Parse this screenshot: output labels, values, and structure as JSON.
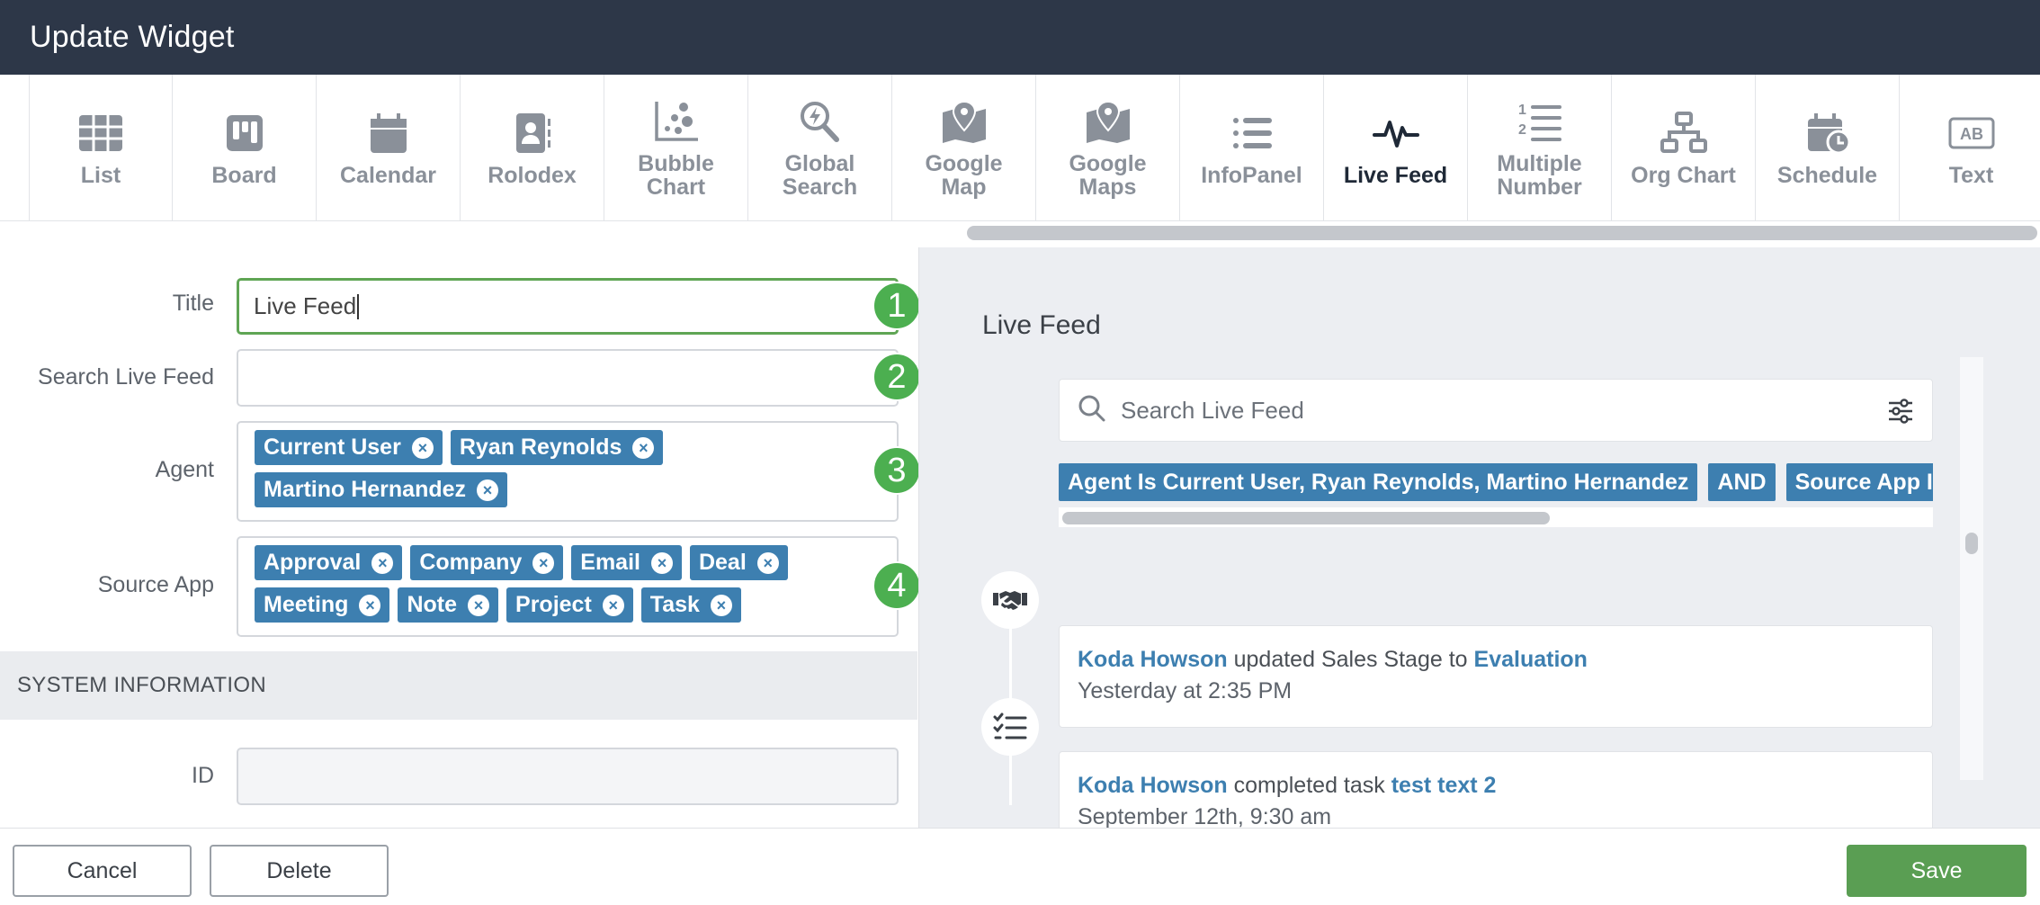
{
  "header": {
    "title": "Update Widget"
  },
  "widget_types": [
    {
      "label": "List",
      "icon": "list-icon",
      "active": false
    },
    {
      "label": "Board",
      "icon": "board-icon",
      "active": false
    },
    {
      "label": "Calendar",
      "icon": "calendar-icon",
      "active": false
    },
    {
      "label": "Rolodex",
      "icon": "rolodex-icon",
      "active": false
    },
    {
      "label": "Bubble\nChart",
      "icon": "bubble-chart-icon",
      "active": false
    },
    {
      "label": "Global\nSearch",
      "icon": "global-search-icon",
      "active": false
    },
    {
      "label": "Google\nMap",
      "icon": "map-icon",
      "active": false
    },
    {
      "label": "Google\nMaps",
      "icon": "maps-icon",
      "active": false
    },
    {
      "label": "InfoPanel",
      "icon": "info-panel-icon",
      "active": false
    },
    {
      "label": "Live Feed",
      "icon": "pulse-icon",
      "active": true
    },
    {
      "label": "Multiple\nNumber",
      "icon": "numbered-list-icon",
      "active": false
    },
    {
      "label": "Org Chart",
      "icon": "org-chart-icon",
      "active": false
    },
    {
      "label": "Schedule",
      "icon": "schedule-icon",
      "active": false
    },
    {
      "label": "Text",
      "icon": "text-icon",
      "active": false
    }
  ],
  "form": {
    "title": {
      "label": "Title",
      "value": "Live Feed",
      "badge": "1"
    },
    "search": {
      "label": "Search Live Feed",
      "value": "",
      "badge": "2"
    },
    "agent": {
      "label": "Agent",
      "badge": "3",
      "tags": [
        "Current User",
        "Ryan Reynolds",
        "Martino Hernandez"
      ]
    },
    "source_app": {
      "label": "Source App",
      "badge": "4",
      "tags": [
        "Approval",
        "Company",
        "Email",
        "Deal",
        "Meeting",
        "Note",
        "Project",
        "Task"
      ]
    },
    "tag_remove_glyph": "×",
    "system_section": "SYSTEM INFORMATION",
    "id": {
      "label": "ID",
      "value": ""
    }
  },
  "preview": {
    "title": "Live Feed",
    "search_placeholder": "Search Live Feed",
    "chips": [
      "Agent Is Current User, Ryan Reynolds, Martino Hernandez",
      "AND",
      "Source App Is"
    ],
    "feed": [
      {
        "actor": "Koda Howson",
        "action": "updated Sales Stage to",
        "target": "Evaluation",
        "time": "Yesterday at 2:35 PM",
        "icon": "handshake-icon"
      },
      {
        "actor": "Koda Howson",
        "action": "completed task",
        "target": "test text 2",
        "time": "September 12th, 9:30 am",
        "icon": "task-list-icon"
      }
    ]
  },
  "footer": {
    "cancel": "Cancel",
    "delete": "Delete",
    "save": "Save"
  },
  "colors": {
    "header_bg": "#2d3748",
    "tag_blue": "#3d7fb0",
    "badge_green": "#4caf50",
    "save_green": "#5a9e53",
    "focus_green": "#5fa554"
  }
}
